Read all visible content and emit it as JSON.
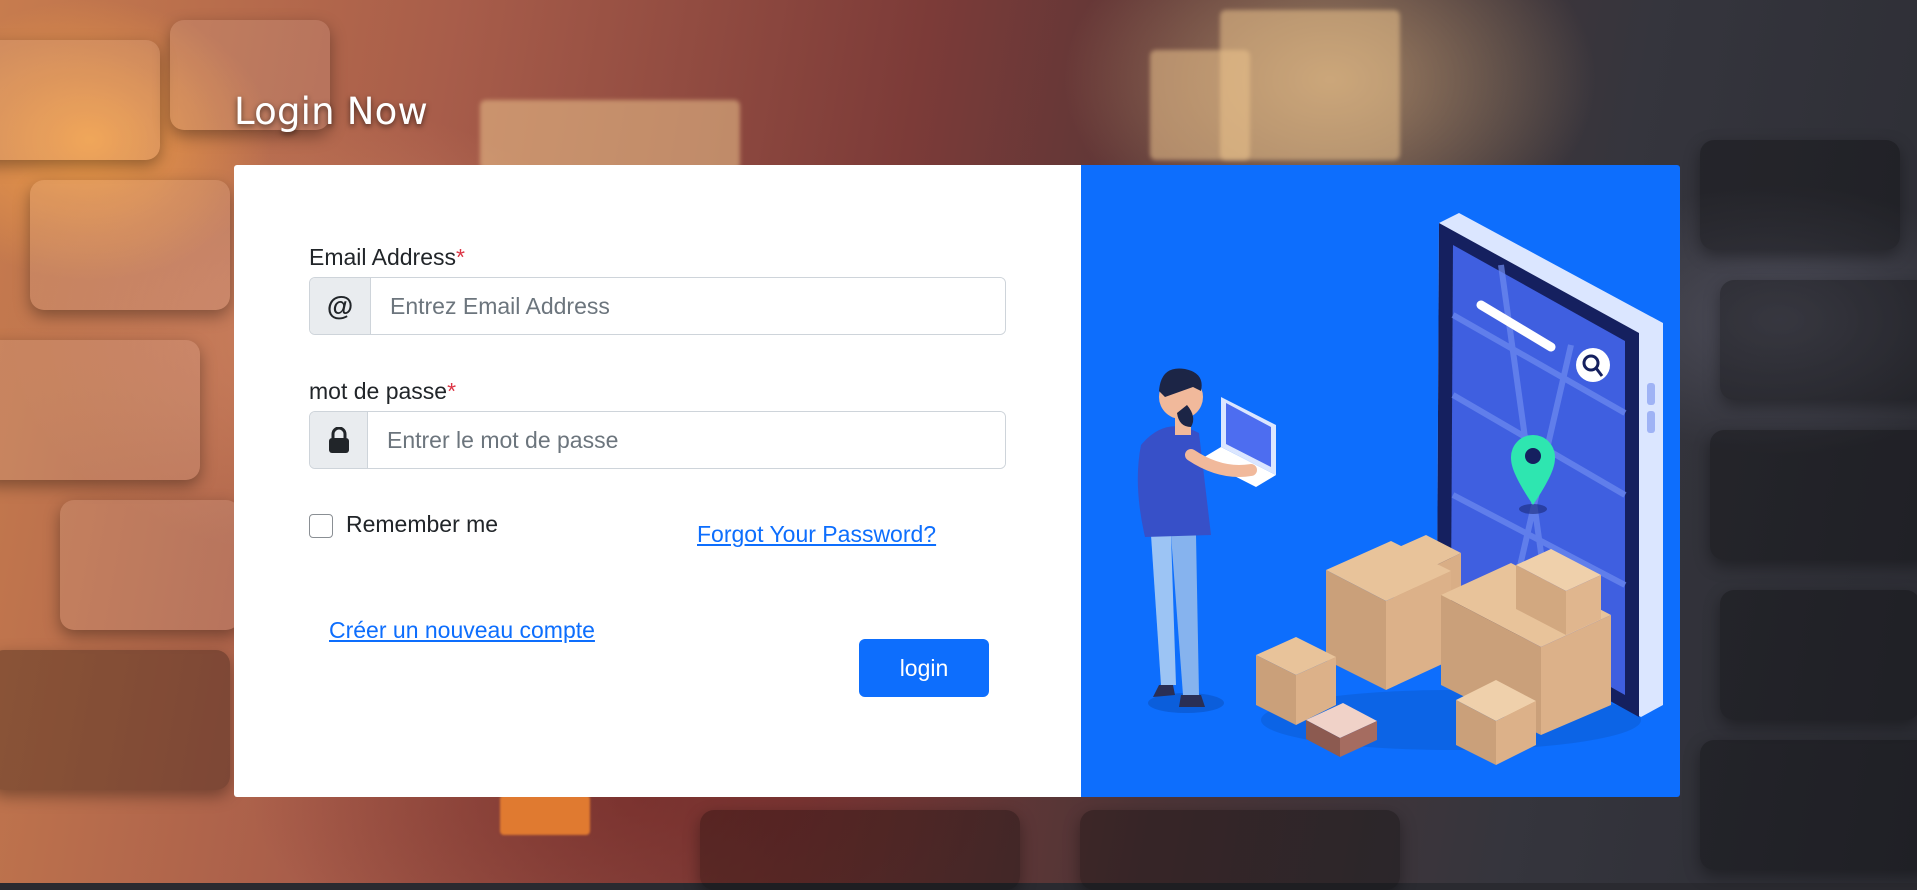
{
  "page": {
    "title": "Login Now"
  },
  "form": {
    "email": {
      "label": "Email Address",
      "required_mark": "*",
      "addon_icon": "at-sign-icon",
      "addon_text": "@",
      "placeholder": "Entrez Email Address",
      "value": ""
    },
    "password": {
      "label": "mot de passe",
      "required_mark": "*",
      "addon_icon": "lock-icon",
      "placeholder": "Entrer le mot de passe",
      "value": ""
    },
    "remember_label": "Remember me",
    "remember_checked": false,
    "forgot_link": "Forgot Your Password?",
    "register_link": "Créer un nouveau compte",
    "submit_label": "login"
  },
  "colors": {
    "primary": "#0d6efd",
    "required": "#dc3545",
    "illustration_bg": "#0d6efd"
  },
  "illustration": {
    "subject": "delivery-person-with-laptop-and-parcels-beside-phone-map-icon"
  }
}
